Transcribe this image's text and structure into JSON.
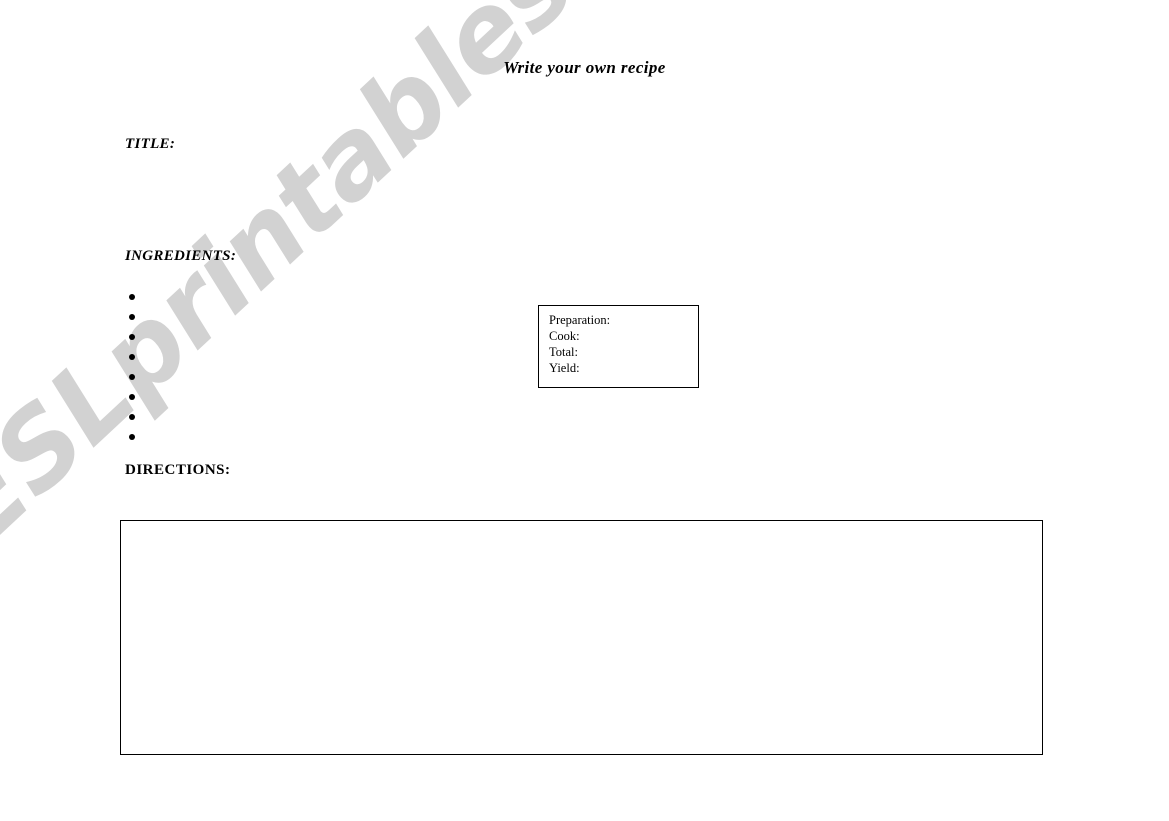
{
  "page": {
    "title": "Write your own recipe",
    "background_color": "#ffffff",
    "text_color": "#000000"
  },
  "sections": {
    "title_label": "TITLE:",
    "ingredients_label": "INGREDIENTS:",
    "directions_label": "DIRECTIONS:"
  },
  "title_field": {
    "value": "",
    "placeholder": ""
  },
  "ingredients": {
    "bullet_count": 8,
    "items": [
      {
        "bullet": "•",
        "value": ""
      },
      {
        "bullet": "•",
        "value": ""
      },
      {
        "bullet": "•",
        "value": ""
      },
      {
        "bullet": "•",
        "value": ""
      },
      {
        "bullet": "•",
        "value": ""
      },
      {
        "bullet": "•",
        "value": ""
      },
      {
        "bullet": "•",
        "value": ""
      },
      {
        "bullet": "•",
        "value": ""
      }
    ]
  },
  "timing_box": {
    "rows": [
      {
        "label": "Preparation:",
        "value": ""
      },
      {
        "label": "Cook:",
        "value": ""
      },
      {
        "label": "Total:",
        "value": ""
      },
      {
        "label": "Yield:",
        "value": ""
      }
    ]
  },
  "directions_box": {
    "value": "",
    "placeholder": ""
  },
  "watermark": {
    "text": "ESLprintables.com",
    "color": "#d2d2d2"
  }
}
